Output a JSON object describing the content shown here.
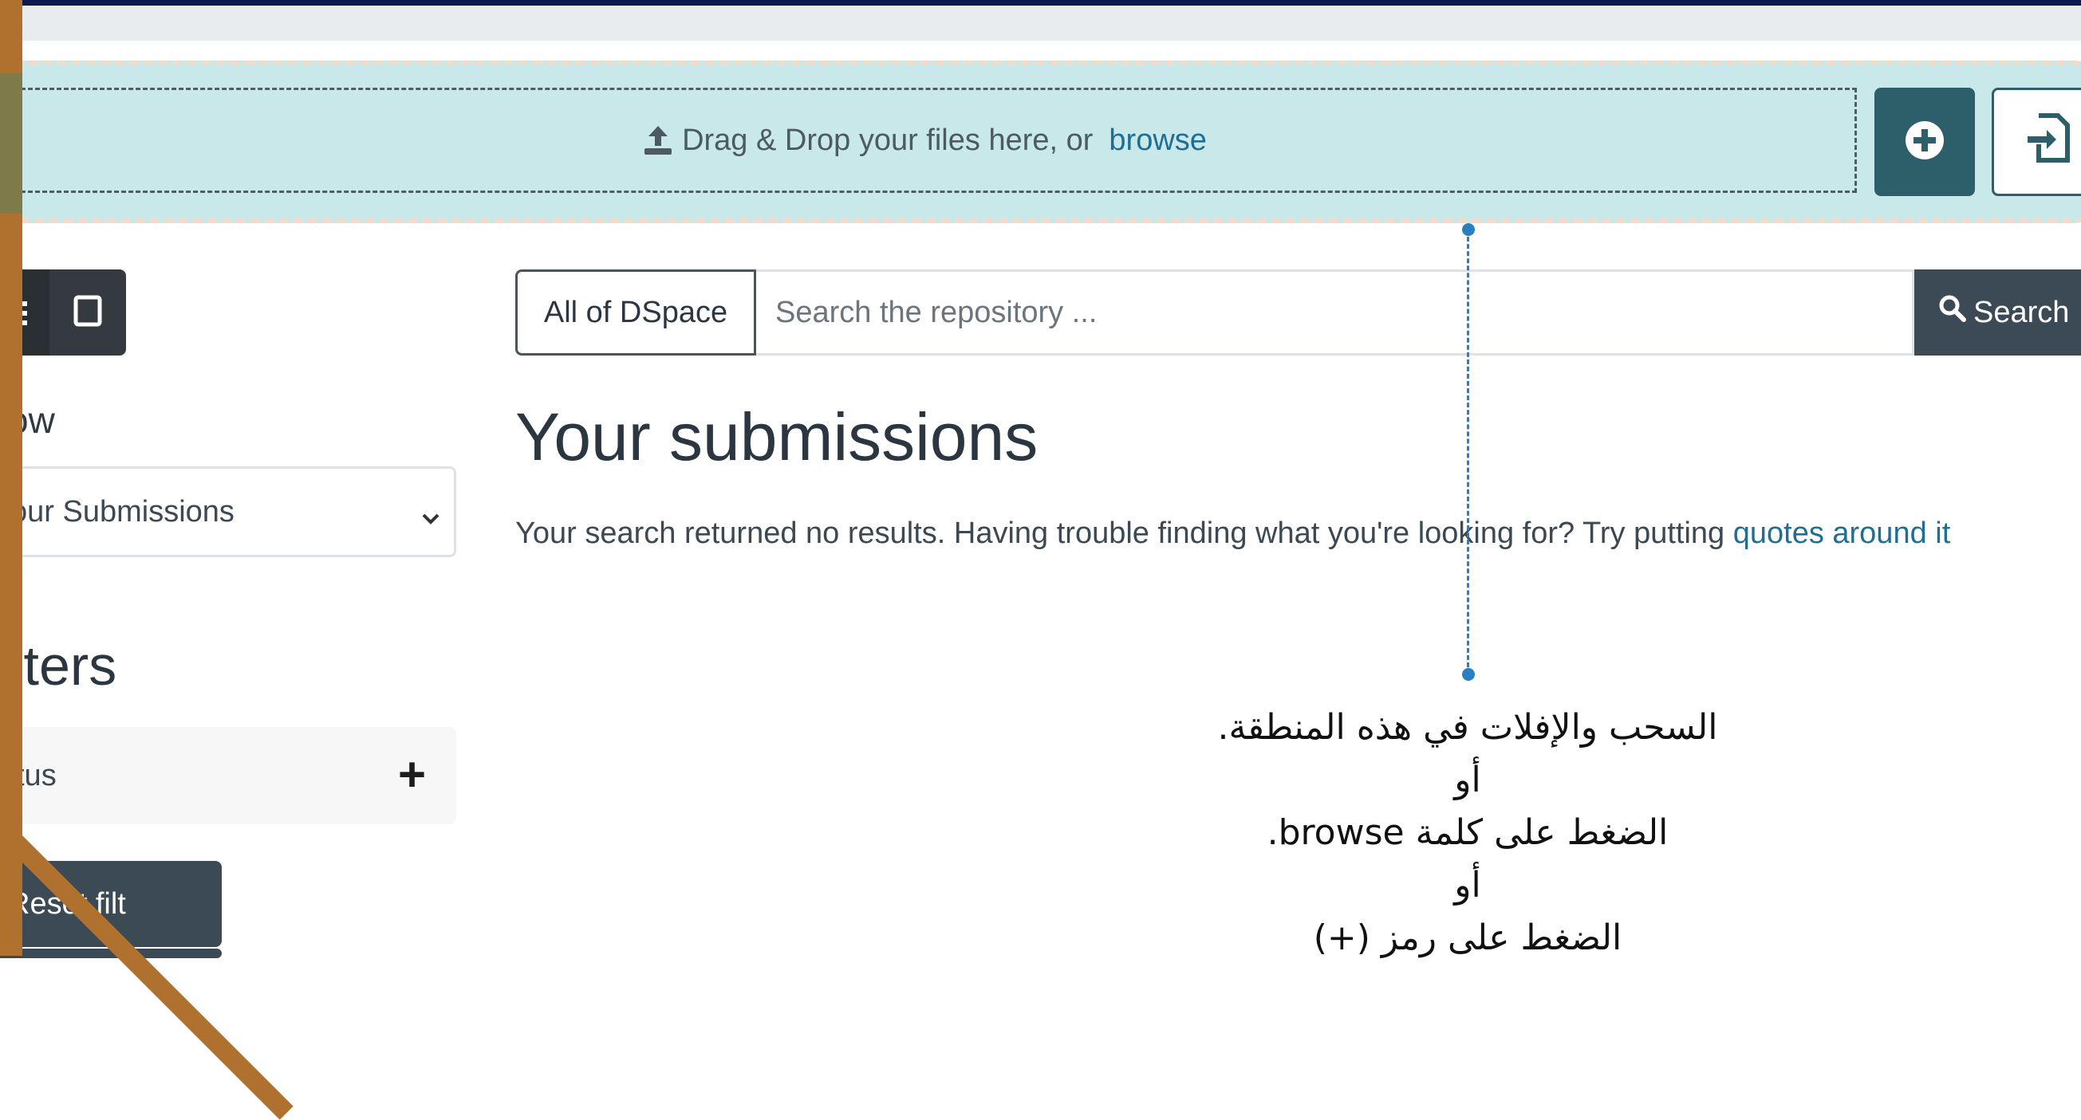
{
  "colors": {
    "accent": "#2c5f69",
    "link": "#1f6f95",
    "dropzone_bg": "#c8e8ea",
    "dark_button": "#3c4a55",
    "frame": "#b0712e",
    "callout": "#2a7fc0"
  },
  "uploader": {
    "text": "Drag & Drop your files here, or",
    "browse_label": "browse",
    "upload_icon": "upload-icon",
    "add_icon": "plus-circle-icon",
    "import_icon": "file-import-icon"
  },
  "sidebar": {
    "view_toggle": {
      "list_icon": "list-icon",
      "grid_icon": "grid-icon"
    },
    "show_label": "ow",
    "show_select_value": "our Submissions",
    "filters_heading": "lters",
    "status_filter_label": "tus",
    "status_filter_toggle": "+",
    "reset_button_label": "Reset filt"
  },
  "search": {
    "scope_label": "All of DSpace",
    "placeholder": "Search the repository ...",
    "button_label": "Search"
  },
  "main": {
    "title": "Your submissions",
    "results_text": "Your search returned no results. Having trouble finding what you're looking for? Try putting",
    "quotes_link": "quotes around it"
  },
  "callout": {
    "lines": [
      "السحب والإفلات في هذه المنطقة.",
      "أو",
      "الضغط على كلمة browse.",
      "أو",
      "الضغط على رمز (+)"
    ]
  }
}
